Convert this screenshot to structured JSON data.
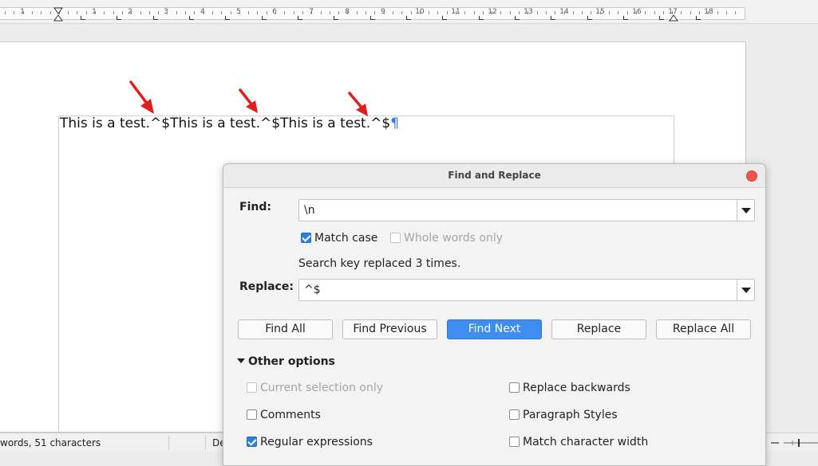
{
  "ruler": {
    "numbers": [
      "1",
      "1",
      "2",
      "3",
      "4",
      "5",
      "6",
      "7",
      "8",
      "9",
      "10",
      "11",
      "12",
      "13",
      "14",
      "15",
      "16",
      "17",
      "18"
    ]
  },
  "document": {
    "segments": [
      "This is a test.^$",
      "This is a test.^$",
      "This is a test.^$"
    ],
    "pilcrow": "¶"
  },
  "statusbar": {
    "word_count": "words, 51 characters",
    "language": "De"
  },
  "dialog": {
    "title": "Find and Replace",
    "find_label": "Find:",
    "find_value": "\\n",
    "match_case": "Match case",
    "whole_words": "Whole words only",
    "status": "Search key replaced 3 times.",
    "replace_label": "Replace:",
    "replace_value": "^$",
    "buttons": {
      "find_all": "Find All",
      "find_previous": "Find Previous",
      "find_next": "Find Next",
      "replace": "Replace",
      "replace_all": "Replace All"
    },
    "other_options": "Other options",
    "options": {
      "current_selection_only": "Current selection only",
      "replace_backwards": "Replace backwards",
      "comments": "Comments",
      "paragraph_styles": "Paragraph Styles",
      "regular_expressions": "Regular expressions",
      "match_character_width": "Match character width"
    },
    "accent_color": "#3d8ef0",
    "close_color": "#ef5350"
  },
  "annotations": {
    "arrow_color": "#e11d1d"
  }
}
